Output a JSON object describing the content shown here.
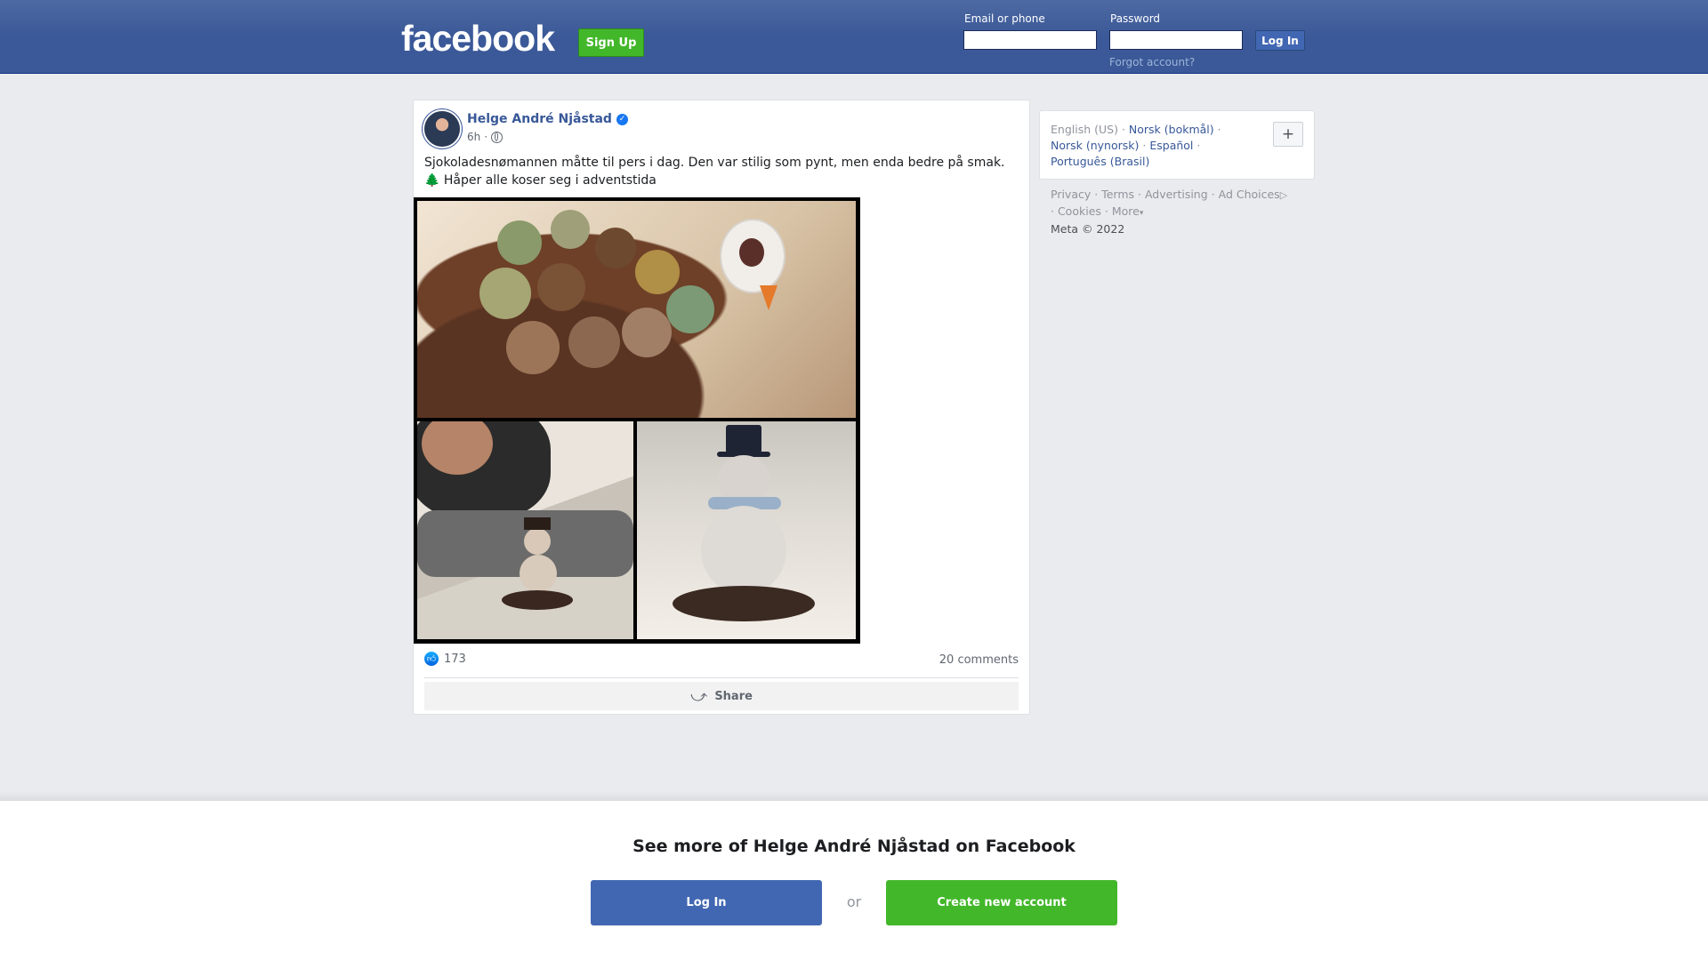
{
  "header": {
    "logo": "facebook",
    "signup_label": "Sign Up",
    "email_label": "Email or phone",
    "email_value": "",
    "password_label": "Password",
    "password_value": "",
    "login_label": "Log In",
    "forgot_label": "Forgot account?"
  },
  "post": {
    "author": "Helge André Njåstad",
    "verified_icon": "verified-checkmark",
    "time": "6h",
    "separator": "·",
    "privacy_icon": "globe",
    "text_line1": "Sjokoladesnømannen måtte til pers i dag. Den var stilig som pynt, men enda bedre på smak.",
    "text_line2_emoji": "🌲",
    "text_line2": "Håper alle koser seg i adventstida",
    "like_icon": "thumbs-up",
    "reactions_count": "173",
    "comments_label": "20 comments",
    "share_label": "Share",
    "share_icon": "share-arrow"
  },
  "sidebar": {
    "languages": {
      "current": "English (US)",
      "links": [
        "Norsk (bokmål)",
        "Norsk (nynorsk)",
        "Español",
        "Português (Brasil)"
      ],
      "add_label": "+"
    },
    "footer": {
      "privacy": "Privacy",
      "terms": "Terms",
      "advertising": "Advertising",
      "ad_choices": "Ad Choices",
      "cookies": "Cookies",
      "more": "More",
      "copyright": "Meta © 2022"
    }
  },
  "bottom": {
    "title": "See more of Helge André Njåstad on Facebook",
    "login_label": "Log In",
    "or_label": "or",
    "create_label": "Create new account"
  },
  "colors": {
    "brand_blue": "#3b5998",
    "login_blue": "#4267b2",
    "green": "#42b72a",
    "link": "#385898"
  }
}
